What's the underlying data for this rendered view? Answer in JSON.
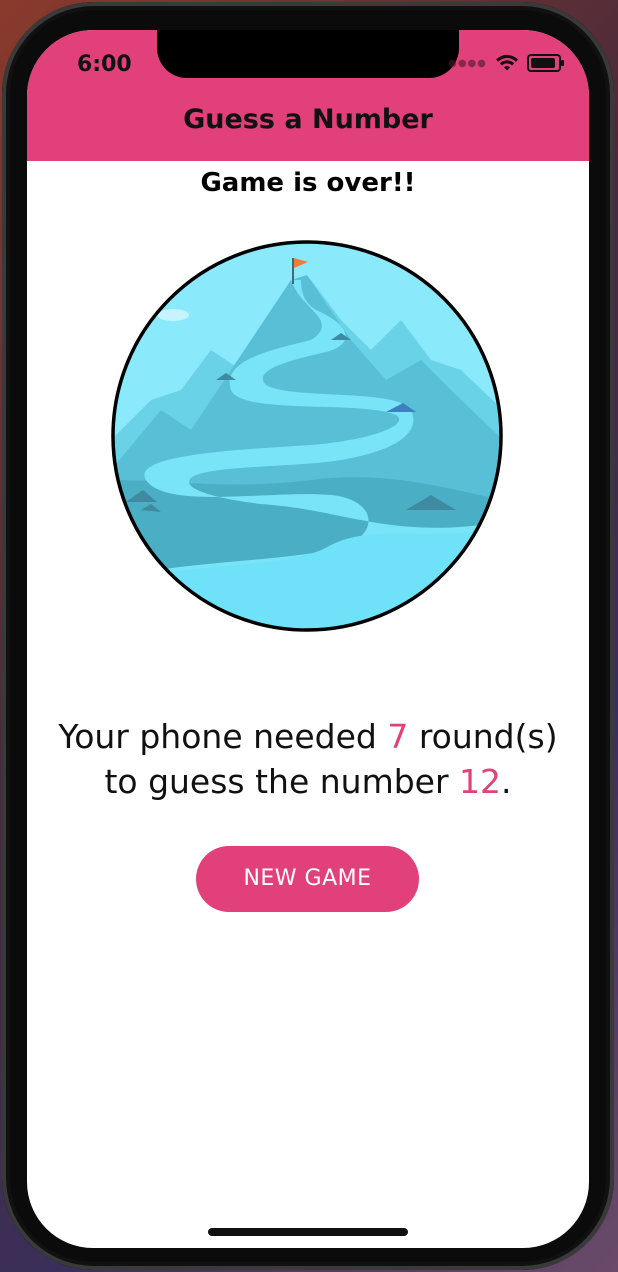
{
  "status_bar": {
    "time": "6:00"
  },
  "header": {
    "title": "Guess a Number"
  },
  "main": {
    "subtitle": "Game is over!!",
    "image_icon": "mountain-summit-illustration",
    "result": {
      "part1": "Your phone needed ",
      "rounds": "7",
      "part2": " round(s)",
      "part3": "to guess the number ",
      "number": "12",
      "part4": "."
    },
    "new_game_button": "NEW GAME"
  },
  "colors": {
    "accent": "#e2407a",
    "sky": "#8ae9fb",
    "river": "#6fe1f9"
  }
}
